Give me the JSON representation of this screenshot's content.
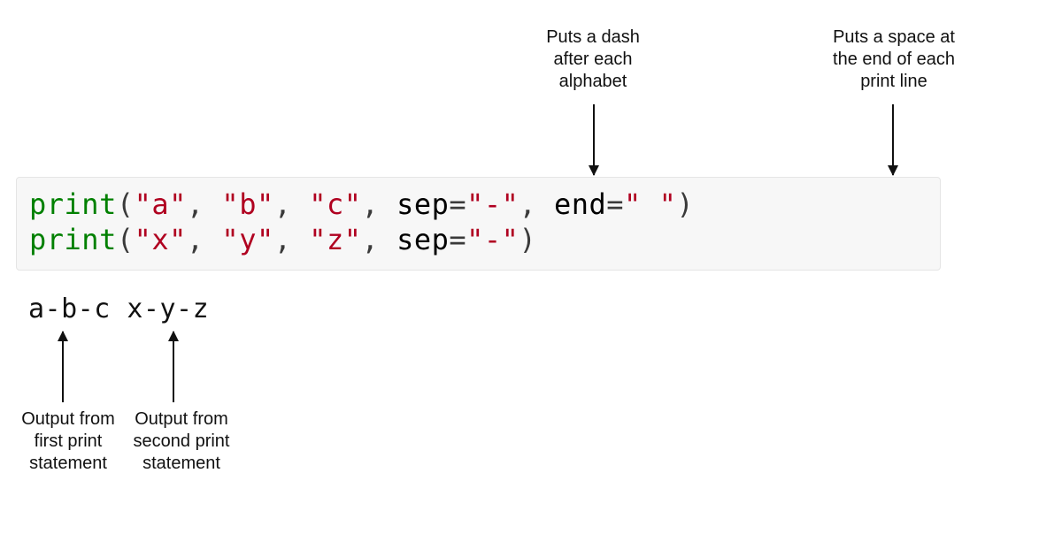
{
  "annotations": {
    "top_sep": "Puts a dash\nafter each\nalphabet",
    "top_end": "Puts a space at\nthe end of each\nprint line",
    "out_first": "Output from\nfirst print\nstatement",
    "out_second": "Output from\nsecond print\nstatement"
  },
  "code": {
    "line1": {
      "func": "print",
      "open": "(",
      "arg_a": "\"a\"",
      "c1": ", ",
      "arg_b": "\"b\"",
      "c2": ", ",
      "arg_c": "\"c\"",
      "c3": ", ",
      "sep_kw": "sep",
      "eq1": "=",
      "sep_val": "\"-\"",
      "c4": ", ",
      "end_kw": "end",
      "eq2": "=",
      "end_val": "\" \"",
      "close": ")"
    },
    "line2": {
      "func": "print",
      "open": "(",
      "arg_x": "\"x\"",
      "c1": ", ",
      "arg_y": "\"y\"",
      "c2": ", ",
      "arg_z": "\"z\"",
      "c3": ", ",
      "sep_kw": "sep",
      "eq1": "=",
      "sep_val": "\"-\"",
      "close": ")"
    }
  },
  "output": "a-b-c x-y-z",
  "colors": {
    "func": "#008000",
    "string": "#b00020",
    "punct": "#3a3a3a",
    "bg_code": "#f7f7f7"
  }
}
